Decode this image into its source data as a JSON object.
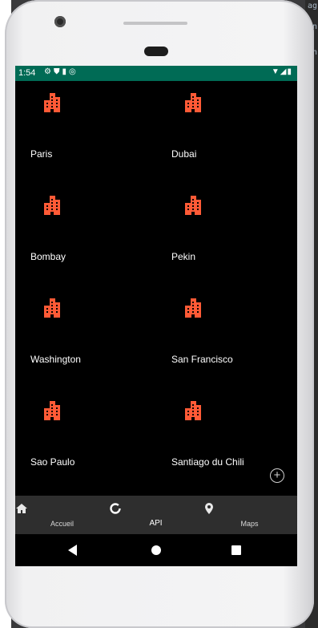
{
  "ide_fragments": [
    "ag",
    "n",
    "n"
  ],
  "status_bar": {
    "time": "1:54",
    "left_icons": [
      "gear-icon",
      "shield-icon",
      "sd-card-icon",
      "sync-icon"
    ],
    "right_icons": [
      "wifi-icon",
      "signal-icon",
      "battery-icon"
    ],
    "color": "#006b55"
  },
  "accent_color": "#ff5a36",
  "cities": [
    {
      "name": "Paris"
    },
    {
      "name": "Dubai"
    },
    {
      "name": "Bombay"
    },
    {
      "name": "Pekin"
    },
    {
      "name": "Washington"
    },
    {
      "name": "San Francisco"
    },
    {
      "name": "Sao Paulo"
    },
    {
      "name": "Santiago du Chili"
    }
  ],
  "fab": {
    "icon": "add-circle-icon",
    "symbol": "+"
  },
  "bottom_nav": {
    "items": [
      {
        "label": "Accueil",
        "icon": "home-icon",
        "active": false
      },
      {
        "label": "API",
        "icon": "loading-circle-icon",
        "active": true
      },
      {
        "label": "Maps",
        "icon": "map-pin-icon",
        "active": false
      }
    ]
  },
  "system_nav": [
    "back-icon",
    "home-icon",
    "recents-icon"
  ]
}
